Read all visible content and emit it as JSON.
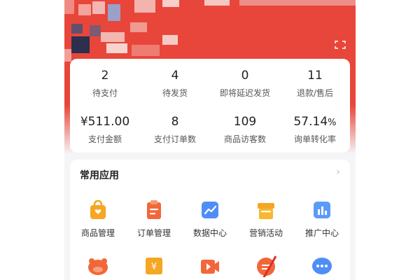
{
  "stats": {
    "row1": [
      {
        "value": "2",
        "label": "待支付"
      },
      {
        "value": "4",
        "label": "待发货"
      },
      {
        "value": "0",
        "label": "即将延迟发货"
      },
      {
        "value": "11",
        "label": "退款/售后"
      }
    ],
    "row2": [
      {
        "value": "¥511.00",
        "label": "支付金额"
      },
      {
        "value": "8",
        "label": "支付订单数"
      },
      {
        "value": "109",
        "label": "商品访客数"
      },
      {
        "value": "57.14",
        "unit": "%",
        "label": "询单转化率"
      }
    ]
  },
  "apps": {
    "title": "常用应用",
    "chevron": "›",
    "items": [
      {
        "label": "商品管理",
        "icon": "shopping-bag-icon"
      },
      {
        "label": "订单管理",
        "icon": "clipboard-icon"
      },
      {
        "label": "数据中心",
        "icon": "line-chart-icon"
      },
      {
        "label": "营销活动",
        "icon": "gift-box-icon"
      },
      {
        "label": "推广中心",
        "icon": "bar-chart-icon"
      }
    ],
    "row2_icons": [
      "piggy-mascot-icon",
      "coupon-icon",
      "video-play-icon",
      "message-bubble-icon",
      "chat-dots-icon"
    ]
  },
  "colors": {
    "brand_red": "#e8463a",
    "orange": "#f5a623",
    "blue": "#4f8ef7",
    "deep_orange": "#f2673a"
  }
}
